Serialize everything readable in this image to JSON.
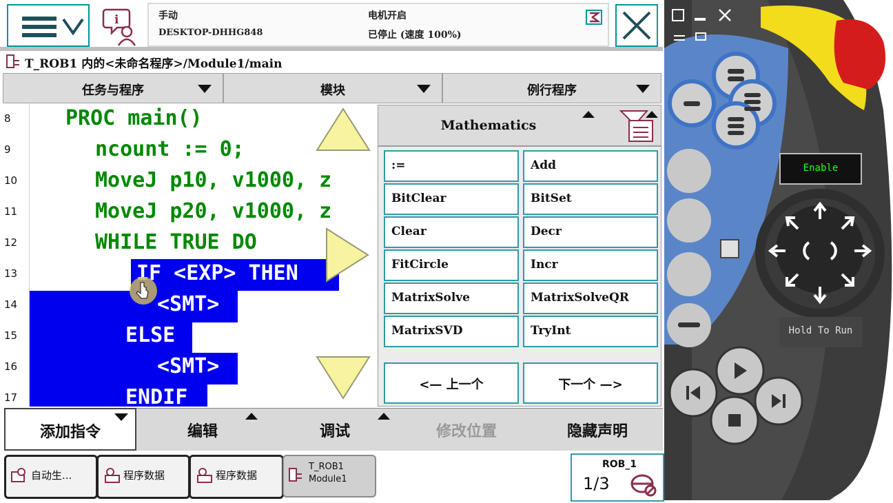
{
  "status": {
    "mode": "手动",
    "device": "DESKTOP-DHHG848",
    "motor": "电机开启",
    "state": "已停止 (速度 100%)"
  },
  "path": "T_ROB1 内的<未命名程序>/Module1/main",
  "dropdowns": [
    "任务与程序",
    "模块",
    "例行程序"
  ],
  "code": {
    "line_numbers": [
      "8",
      "9",
      "10",
      "11",
      "12",
      "13",
      "14",
      "15",
      "16",
      "17"
    ],
    "lines": [
      "PROC main()",
      "ncount := 0;",
      "MoveJ p10, v1000, z",
      "MoveJ p20, v1000, z",
      "WHILE TRUE DO",
      "IF <EXP> THEN",
      "<SMT>",
      "ELSE",
      "<SMT>",
      "ENDIF"
    ]
  },
  "math_panel": {
    "title": "Mathematics",
    "functions": [
      ":=",
      "Add",
      "BitClear",
      "BitSet",
      "Clear",
      "Decr",
      "FitCircle",
      "Incr",
      "MatrixSolve",
      "MatrixSolveQR",
      "MatrixSVD",
      "TryInt"
    ],
    "prev": "<—  上一个",
    "next": "下一个  —>"
  },
  "toolbar": [
    "添加指令",
    "编辑",
    "调试",
    "修改位置",
    "隐藏声明"
  ],
  "taskbar": {
    "items": [
      "自动生...",
      "程序数据",
      "程序数据"
    ],
    "active_line1": "T_ROB1",
    "active_line2": "Module1",
    "robot_label": "ROB_1",
    "fraction": "1/3"
  },
  "flexpendant": {
    "enable_label": "Enable",
    "hold_label": "Hold To Run"
  },
  "colors": {
    "accent": "#00969a",
    "code_green": "#008800",
    "selection_blue": "#0000ee",
    "enable_green": "#22ff22",
    "estop_red": "#d51c1c",
    "yellow": "#f2dc1c"
  }
}
